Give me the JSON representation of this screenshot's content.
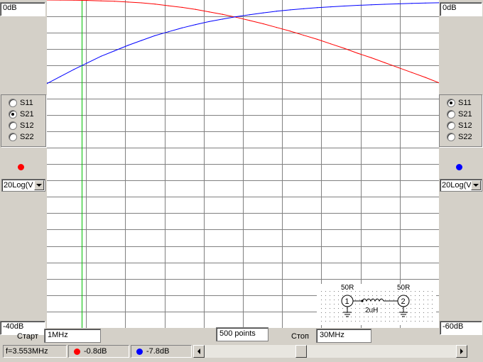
{
  "left_panel": {
    "scale_top": "0dB",
    "scale_bottom": "-40dB",
    "params": [
      {
        "label": "S11",
        "selected": false
      },
      {
        "label": "S21",
        "selected": true
      },
      {
        "label": "S12",
        "selected": false
      },
      {
        "label": "S22",
        "selected": false
      }
    ],
    "trace_color": "#ff0000",
    "mode": "20Log(V"
  },
  "right_panel": {
    "scale_top": "0dB",
    "scale_bottom": "-60dB",
    "params": [
      {
        "label": "S11",
        "selected": true
      },
      {
        "label": "S21",
        "selected": false
      },
      {
        "label": "S12",
        "selected": false
      },
      {
        "label": "S22",
        "selected": false
      }
    ],
    "trace_color": "#0000ff",
    "mode": "20Log(V"
  },
  "sweep": {
    "start_label": "Старт",
    "start_value": "1MHz",
    "points": "500 points",
    "stop_label": "Стоп",
    "stop_value": "30MHz"
  },
  "status": {
    "frequency": "f=3.553MHz",
    "left_value": "-0.8dB",
    "right_value": "-7.8dB",
    "scroll_position": 0.38
  },
  "circuit": {
    "port1_impedance": "50R",
    "port2_impedance": "50R",
    "port1_label": "1",
    "port2_label": "2",
    "inductor_value": "2uH"
  },
  "colors": {
    "red_trace": "#ff0000",
    "blue_trace": "#0000ff",
    "marker": "#00c000",
    "grid": "#808080"
  },
  "chart_data": {
    "type": "line",
    "xlim": [
      1,
      30
    ],
    "x_unit": "MHz",
    "grid": true,
    "marker_x": 3.553,
    "series": [
      {
        "name": "S21",
        "color": "#ff0000",
        "axis": "left",
        "ylim": [
          -40,
          0
        ],
        "x": [
          1,
          2,
          3,
          4,
          5,
          6,
          7,
          8,
          9,
          10,
          11,
          12,
          13,
          14,
          15,
          16,
          17,
          18,
          19,
          20,
          21,
          22,
          23,
          24,
          25,
          26,
          27,
          28,
          29,
          30
        ],
        "y": [
          0,
          -0.01,
          -0.02,
          -0.05,
          -0.1,
          -0.15,
          -0.25,
          -0.35,
          -0.5,
          -0.7,
          -0.9,
          -1.15,
          -1.45,
          -1.75,
          -2.1,
          -2.5,
          -2.9,
          -3.35,
          -3.8,
          -4.3,
          -4.8,
          -5.35,
          -5.9,
          -6.5,
          -7.05,
          -7.65,
          -8.25,
          -8.85,
          -9.45,
          -10.1
        ]
      },
      {
        "name": "S11",
        "color": "#0000ff",
        "axis": "right",
        "ylim": [
          -60,
          0
        ],
        "x": [
          1,
          2,
          3,
          4,
          5,
          6,
          7,
          8,
          9,
          10,
          11,
          12,
          13,
          14,
          15,
          16,
          17,
          18,
          19,
          20,
          21,
          22,
          23,
          24,
          25,
          26,
          27,
          28,
          29,
          30
        ],
        "y": [
          -15.3,
          -14.0,
          -12.7,
          -11.5,
          -10.3,
          -9.3,
          -8.3,
          -7.4,
          -6.5,
          -5.8,
          -5.1,
          -4.5,
          -3.95,
          -3.5,
          -3.05,
          -2.7,
          -2.35,
          -2.05,
          -1.8,
          -1.6,
          -1.4,
          -1.25,
          -1.1,
          -0.98,
          -0.88,
          -0.78,
          -0.7,
          -0.62,
          -0.56,
          -0.5
        ]
      }
    ]
  }
}
